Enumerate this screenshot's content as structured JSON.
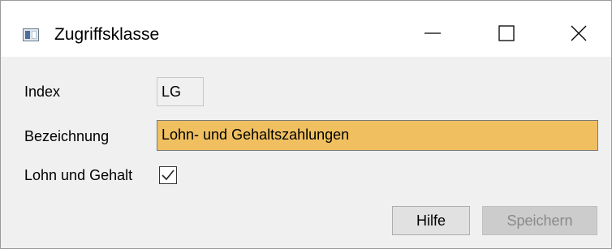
{
  "window": {
    "title": "Zugriffsklasse",
    "icon": "application-window-icon"
  },
  "title_controls": {
    "minimize_icon": "minimize-icon",
    "maximize_icon": "maximize-icon",
    "close_icon": "close-icon"
  },
  "form": {
    "index_label": "Index",
    "index_value": "LG",
    "description_label": "Bezeichnung",
    "description_value": "Lohn- und Gehaltszahlungen",
    "payroll_label": "Lohn und Gehalt",
    "payroll_checked": true
  },
  "buttons": {
    "help_label": "Hilfe",
    "save_label": "Speichern"
  },
  "colors": {
    "highlight_field": "#f0c060",
    "window_bg": "#f0f0f0",
    "disabled_text": "#8a8a8a"
  }
}
